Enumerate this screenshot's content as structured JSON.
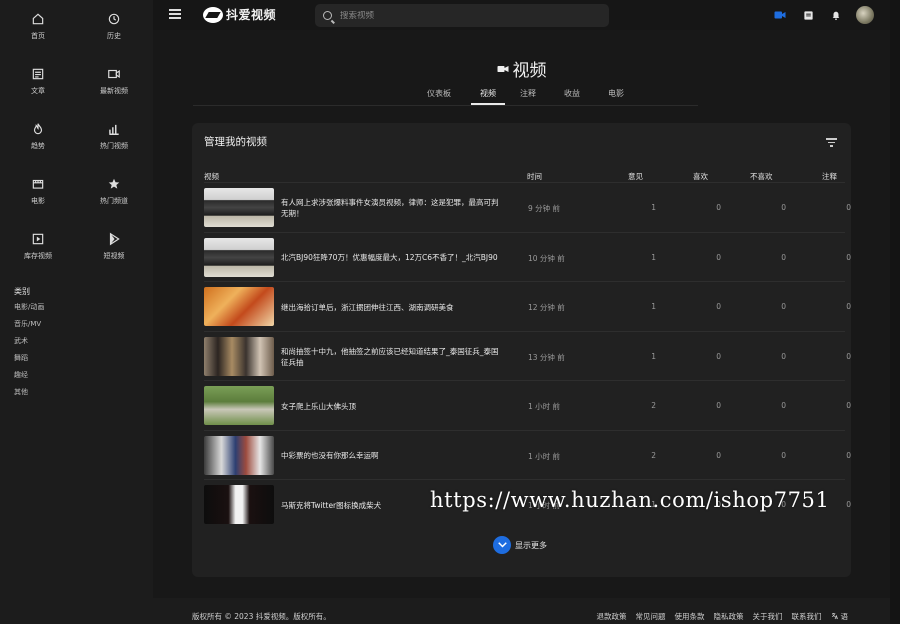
{
  "header": {
    "logo_text": "抖爱视频",
    "search_placeholder": "搜索视频"
  },
  "sidebar": {
    "items": [
      {
        "label": "首页",
        "icon": "home-icon"
      },
      {
        "label": "历史",
        "icon": "history-icon"
      },
      {
        "label": "文章",
        "icon": "article-icon"
      },
      {
        "label": "最新视频",
        "icon": "video-icon"
      },
      {
        "label": "趋势",
        "icon": "fire-icon"
      },
      {
        "label": "热门视频",
        "icon": "bar-chart-icon"
      },
      {
        "label": "电影",
        "icon": "movie-icon"
      },
      {
        "label": "热门频道",
        "icon": "star-icon"
      },
      {
        "label": "库存视频",
        "icon": "play-box-icon"
      },
      {
        "label": "短视频",
        "icon": "shorts-icon"
      }
    ],
    "category_title": "类别",
    "categories": [
      "电影/动画",
      "音乐/MV",
      "武术",
      "舞蹈",
      "趣经",
      "其他"
    ]
  },
  "main": {
    "page_title": "视频",
    "tabs": [
      "仪表板",
      "视频",
      "注释",
      "收益",
      "电影"
    ],
    "active_tab": "视频",
    "card_title": "管理我的视频",
    "columns": {
      "video": "视频",
      "time": "时间",
      "views": "意见",
      "likes": "喜欢",
      "dislikes": "不喜欢",
      "comments": "注释"
    },
    "rows": [
      {
        "title": "有人网上求涉张爆料事件女演员视频，律师：这是犯罪，最高可判无期！",
        "time": "9 分钟 前",
        "views": "1",
        "likes": "0",
        "dislikes": "0",
        "comments": "0",
        "thumb": "car"
      },
      {
        "title": "北汽BJ90狂降70万！优惠幅度最大，12万C6不香了！_北汽BJ90",
        "time": "10 分钟 前",
        "views": "1",
        "likes": "0",
        "dislikes": "0",
        "comments": "0",
        "thumb": "car"
      },
      {
        "title": "继出海拾订单后，浙江掼团伸往江西、湖南调研美食",
        "time": "12 分钟 前",
        "views": "1",
        "likes": "0",
        "dislikes": "0",
        "comments": "0",
        "thumb": "food"
      },
      {
        "title": "和尚抽签十中九，他抽签之前应该已经知道结果了_泰国征兵_泰国征兵抽",
        "time": "13 分钟 前",
        "views": "1",
        "likes": "0",
        "dislikes": "0",
        "comments": "0",
        "thumb": "crowd"
      },
      {
        "title": "女子爬上乐山大佛头顶",
        "time": "1 小时 前",
        "views": "2",
        "likes": "0",
        "dislikes": "0",
        "comments": "0",
        "thumb": "nature"
      },
      {
        "title": "中彩票的也没有你那么幸运啊",
        "time": "1 小时 前",
        "views": "2",
        "likes": "0",
        "dislikes": "0",
        "comments": "0",
        "thumb": "crowd2"
      },
      {
        "title": "马斯克将Twitter图标换成柴犬",
        "time": "1 小时 前",
        "views": "1",
        "likes": "0",
        "dislikes": "0",
        "comments": "0",
        "thumb": "dark"
      }
    ],
    "show_more": "显示更多"
  },
  "footer": {
    "copyright": "版权所有 © 2023 抖爱视频。版权所有。",
    "links": [
      "退款政策",
      "常见问题",
      "使用条款",
      "隐私政策",
      "关于我们",
      "联系我们",
      "语"
    ]
  },
  "watermark": "https://www.huzhan.com/ishop7751",
  "colors": {
    "accent": "#1e6de0",
    "background": "#141414",
    "card": "#212121"
  }
}
